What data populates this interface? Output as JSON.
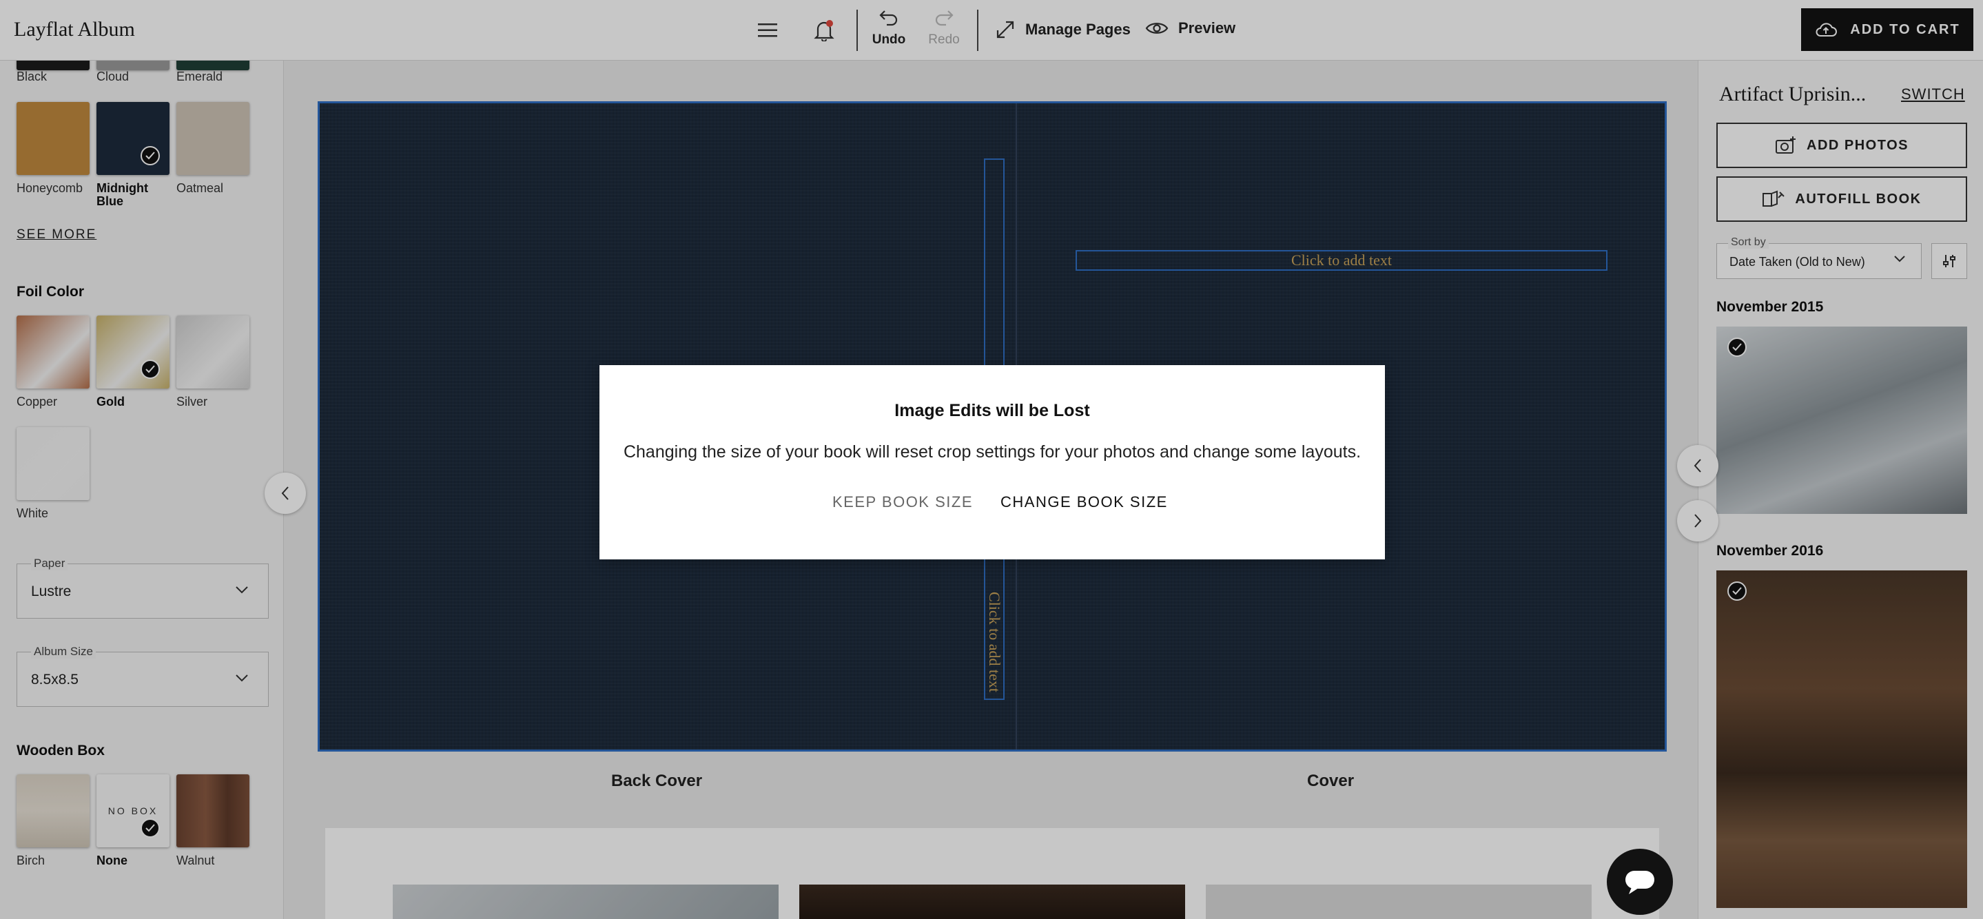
{
  "app": {
    "title": "Layflat Album"
  },
  "toolbar": {
    "undo_label": "Undo",
    "redo_label": "Redo",
    "manage_pages_label": "Manage Pages",
    "preview_label": "Preview",
    "add_to_cart_label": "ADD TO CART"
  },
  "left": {
    "cover_colors_top": [
      {
        "label": "Black",
        "color": "#1b1b1b"
      },
      {
        "label": "Cloud",
        "color": "#9a9a9a"
      },
      {
        "label": "Emerald",
        "color": "#1f3f36"
      }
    ],
    "cover_colors": [
      {
        "label": "Honeycomb",
        "color": "#c08a3e",
        "selected": false
      },
      {
        "label": "Midnight Blue",
        "color": "#1d2b3d",
        "selected": true
      },
      {
        "label": "Oatmeal",
        "color": "#cfc4b6",
        "selected": false
      }
    ],
    "see_more_label": "SEE MORE",
    "foil_title": "Foil Color",
    "foil_colors": [
      {
        "label": "Copper",
        "color": "#b56f4a",
        "selected": false
      },
      {
        "label": "Gold",
        "color": "#c8b26a",
        "selected": true
      },
      {
        "label": "Silver",
        "color": "#cfcfcf",
        "selected": false
      },
      {
        "label": "White",
        "color": "#f2f2f2",
        "selected": false
      }
    ],
    "paper": {
      "label": "Paper",
      "value": "Lustre"
    },
    "album_size": {
      "label": "Album Size",
      "value": "8.5x8.5"
    },
    "box_title": "Wooden Box",
    "boxes": [
      {
        "label": "Birch",
        "selected": false
      },
      {
        "label": "None",
        "swatch_text": "NO BOX",
        "selected": true
      },
      {
        "label": "Walnut",
        "selected": false
      }
    ]
  },
  "canvas": {
    "spine_placeholder": "Click to add text",
    "cover_placeholder": "Click to add text",
    "back_cover_caption": "Back Cover",
    "cover_caption": "Cover"
  },
  "right": {
    "project_title": "Artifact Uprisin...",
    "switch_label": "SWITCH",
    "add_photos_label": "ADD PHOTOS",
    "autofill_label": "AUTOFILL BOOK",
    "sort": {
      "label": "Sort by",
      "value": "Date Taken (Old to New)"
    },
    "groups": [
      {
        "month": "November 2015"
      },
      {
        "month": "November 2016"
      }
    ]
  },
  "dialog": {
    "title": "Image Edits will be Lost",
    "message": "Changing the size of your book will reset crop settings for your photos and change some layouts.",
    "keep_label": "KEEP BOOK SIZE",
    "change_label": "CHANGE BOOK SIZE"
  }
}
